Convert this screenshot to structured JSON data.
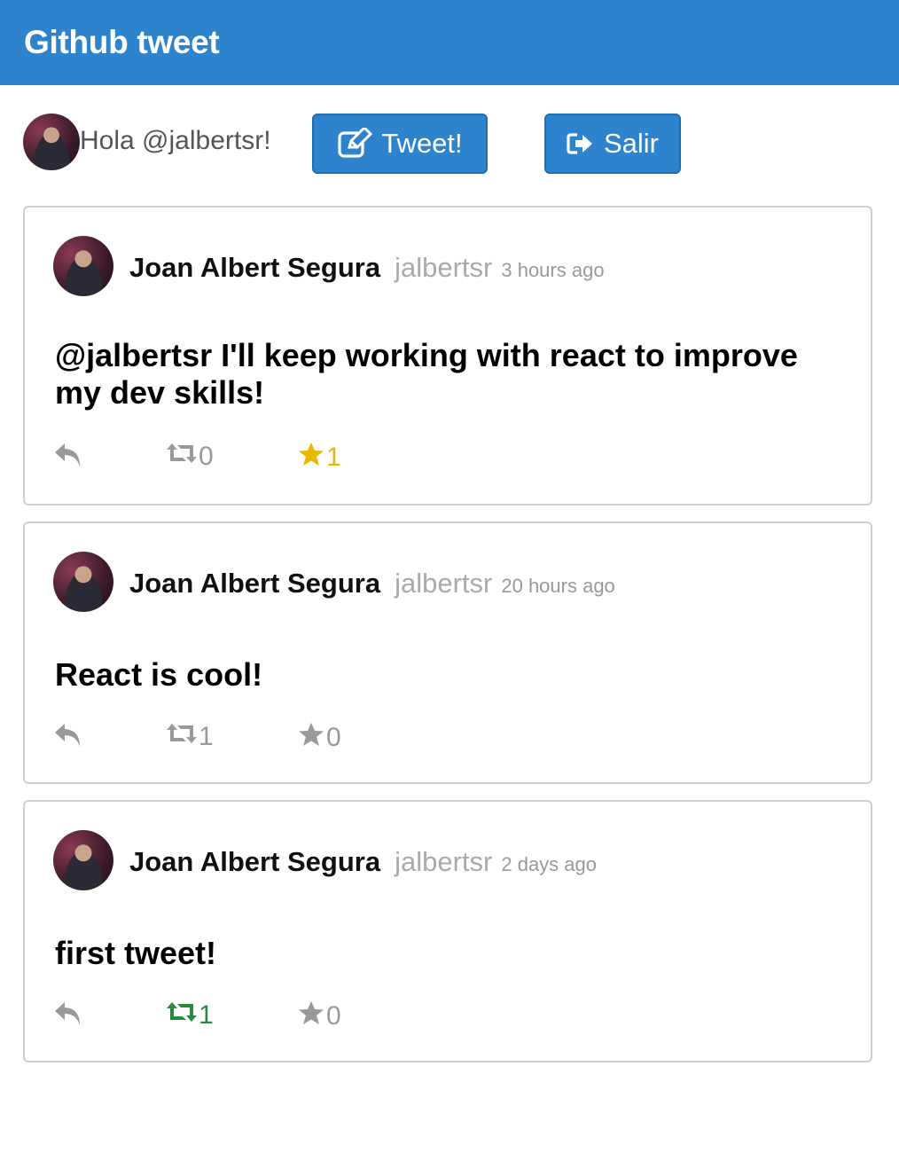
{
  "app": {
    "title": "Github tweet"
  },
  "userbar": {
    "greeting": "Hola @jalbertsr!",
    "tweet_button": "Tweet!",
    "logout_button": "Salir",
    "tweet_icon": "edit-icon",
    "logout_icon": "sign-out-icon"
  },
  "colors": {
    "brand": "#2e84cc",
    "retweeted": "#2a8a3c",
    "favorited": "#e6b800",
    "muted": "#999999"
  },
  "tweets": [
    {
      "name": "Joan Albert Segura",
      "handle": "jalbertsr",
      "time": "3 hours ago",
      "text": "@jalbertsr I'll keep working with react to improve my dev skills!",
      "retweets": "0",
      "favorites": "1",
      "retweeted": false,
      "favorited": true
    },
    {
      "name": "Joan Albert Segura",
      "handle": "jalbertsr",
      "time": "20 hours ago",
      "text": "React is cool!",
      "retweets": "1",
      "favorites": "0",
      "retweeted": false,
      "favorited": false
    },
    {
      "name": "Joan Albert Segura",
      "handle": "jalbertsr",
      "time": "2 days ago",
      "text": "first tweet!",
      "retweets": "1",
      "favorites": "0",
      "retweeted": true,
      "favorited": false
    }
  ]
}
